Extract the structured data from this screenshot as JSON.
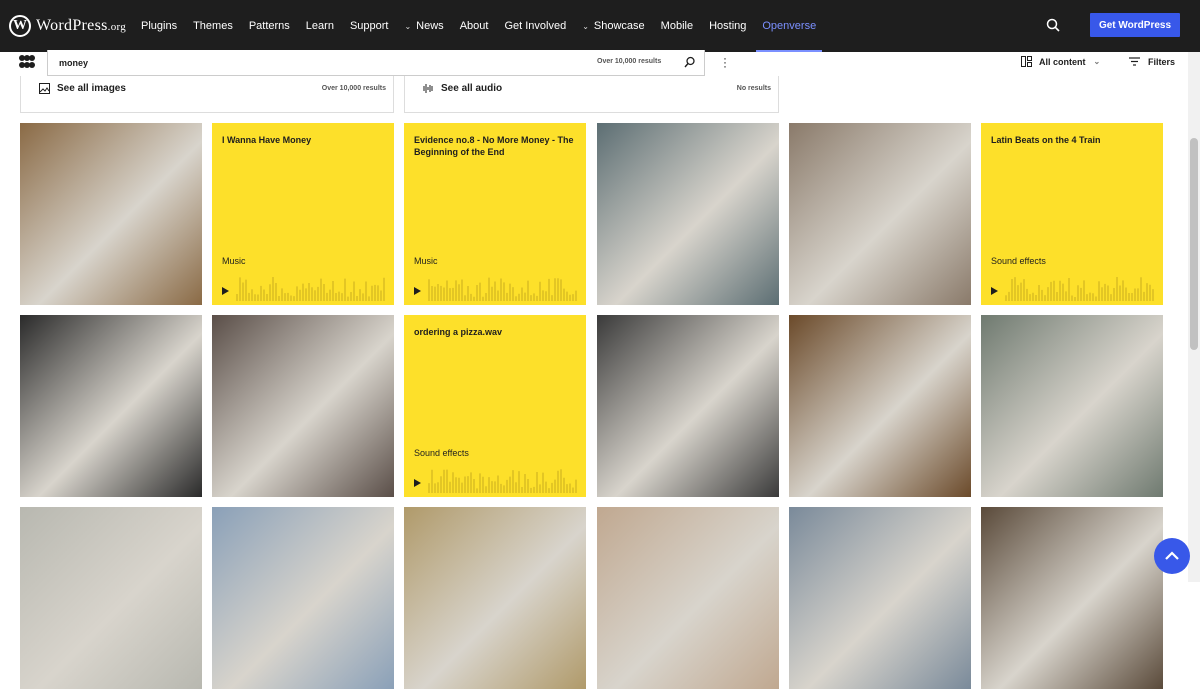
{
  "wp_nav": {
    "logo_text": "WordPress",
    "logo_suffix": ".org",
    "items": [
      {
        "label": "Plugins",
        "caret": false
      },
      {
        "label": "Themes",
        "caret": false
      },
      {
        "label": "Patterns",
        "caret": false
      },
      {
        "label": "Learn",
        "caret": false
      },
      {
        "label": "Support",
        "caret": false
      },
      {
        "label": "News",
        "caret": true
      },
      {
        "label": "About",
        "caret": false
      },
      {
        "label": "Get Involved",
        "caret": false
      },
      {
        "label": "Showcase",
        "caret": true
      },
      {
        "label": "Mobile",
        "caret": false
      },
      {
        "label": "Hosting",
        "caret": false
      },
      {
        "label": "Openverse",
        "caret": false,
        "active": true
      }
    ],
    "get_wordpress": "Get WordPress"
  },
  "search": {
    "query": "money",
    "result_count": "Over 10,000 results"
  },
  "content_filter": {
    "all_content": "All content",
    "filters": "Filters"
  },
  "see_all": {
    "images_label": "See all images",
    "images_count": "Over 10,000 results",
    "audio_label": "See all audio",
    "audio_count": "No results"
  },
  "results": [
    {
      "type": "image",
      "icon": "people-counting-money-photo",
      "color": "#8a6a45"
    },
    {
      "type": "audio",
      "title": "I Wanna Have Money",
      "category": "Music"
    },
    {
      "type": "audio",
      "title": "Evidence no.8 - No More Money - The Beginning of the End",
      "category": "Music"
    },
    {
      "type": "image",
      "icon": "coins-photo",
      "color": "#5c6e73"
    },
    {
      "type": "image",
      "icon": "banknotes-on-carpet-photo",
      "color": "#8a7a6a"
    },
    {
      "type": "audio",
      "title": "Latin Beats on the 4 Train",
      "category": "Sound effects"
    },
    {
      "type": "image",
      "icon": "pound-notes-fan-photo",
      "color": "#2a2a2a"
    },
    {
      "type": "image",
      "icon": "pound-notes-grid-photo",
      "color": "#5a4e48"
    },
    {
      "type": "audio",
      "title": "ordering a pizza.wav",
      "category": "Sound effects"
    },
    {
      "type": "image",
      "icon": "origami-dollar-photo",
      "color": "#3a3a3a"
    },
    {
      "type": "image",
      "icon": "dollar-bill-photo",
      "color": "#6b4a2a"
    },
    {
      "type": "image",
      "icon": "dollar-bills-closeup-photo",
      "color": "#6f7a70"
    },
    {
      "type": "image",
      "icon": "euro-note-photo",
      "color": "#b8b8b0"
    },
    {
      "type": "image",
      "icon": "euro-notes-grid-paper-photo",
      "color": "#8aa0b8"
    },
    {
      "type": "image",
      "icon": "play-money-note-photo",
      "color": "#b09a6a"
    },
    {
      "type": "image",
      "icon": "yen-notes-photo",
      "color": "#c0a890"
    },
    {
      "type": "image",
      "icon": "spanish-peseta-note-photo",
      "color": "#7a8a9a"
    },
    {
      "type": "image",
      "icon": "stacked-coins-photo",
      "color": "#5a4a3a"
    }
  ]
}
